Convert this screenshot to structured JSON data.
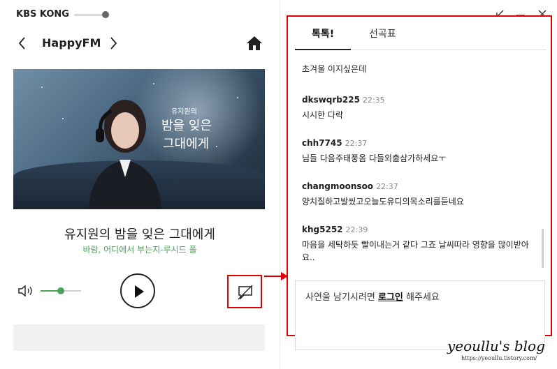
{
  "app": {
    "brand": "KBS KONG"
  },
  "channel": {
    "name": "HappyFM"
  },
  "banner": {
    "caption_small": "유지원의",
    "caption_line1": "밤을 잊은",
    "caption_line2": "그대에게"
  },
  "program": {
    "title": "유지원의 밤을 잊은 그대에게",
    "subtitle": "바람, 어디에서 부는지-루시드 폴"
  },
  "volume": {
    "level": 0.5
  },
  "chat": {
    "tabs": [
      {
        "label": "톡톡!"
      },
      {
        "label": "선곡표"
      }
    ],
    "messages": [
      {
        "user": "",
        "time": "",
        "text": "초겨울 이지싶은데"
      },
      {
        "user": "dkswqrb225",
        "time": "22:35",
        "text": "시시한 다락"
      },
      {
        "user": "chh7745",
        "time": "22:37",
        "text": "님들 다음주태풍옴 다들외출삼가하세요ㅜ"
      },
      {
        "user": "changmoonsoo",
        "time": "22:37",
        "text": "양치질하고발씼고오늘도유디의목소리를듣네요"
      },
      {
        "user": "khg5252",
        "time": "22:39",
        "text": "마음을 세탁하듯 빨이내는거 같다 그죠 날씨따라 영향을 많이받아요.."
      }
    ],
    "input": {
      "prefix": "사연을 남기시려면 ",
      "login": "로그인",
      "suffix": " 해주세요"
    }
  },
  "watermark": {
    "title": "yeoullu's blog",
    "url": "https://yeoullu.tistory.com/"
  },
  "colors": {
    "accent_green": "#4aa35a",
    "highlight_red": "#e00000"
  }
}
